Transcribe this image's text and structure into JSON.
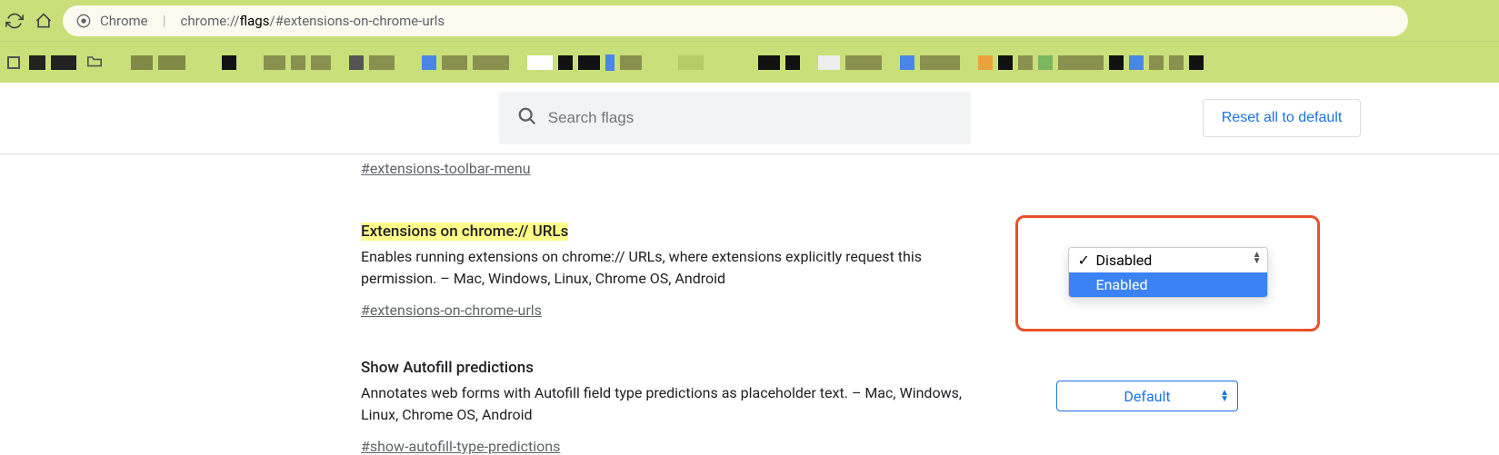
{
  "browser": {
    "url_prefix": "Chrome",
    "url_gray1": "chrome://",
    "url_black": "flags",
    "url_gray2": "/#extensions-on-chrome-urls"
  },
  "search": {
    "placeholder": "Search flags"
  },
  "reset_button": "Reset all to default",
  "peek_flag_hash": "#extensions-toolbar-menu",
  "flag1": {
    "title": "Extensions on chrome:// URLs",
    "desc": "Enables running extensions on chrome:// URLs, where extensions explicitly request this permission. – Mac, Windows, Linux, Chrome OS, Android",
    "hash": "#extensions-on-chrome-urls",
    "option_disabled": "Disabled",
    "option_enabled": "Enabled"
  },
  "flag2": {
    "title": "Show Autofill predictions",
    "desc": "Annotates web forms with Autofill field type predictions as placeholder text. – Mac, Windows, Linux, Chrome OS, Android",
    "hash": "#show-autofill-type-predictions",
    "selected": "Default"
  }
}
